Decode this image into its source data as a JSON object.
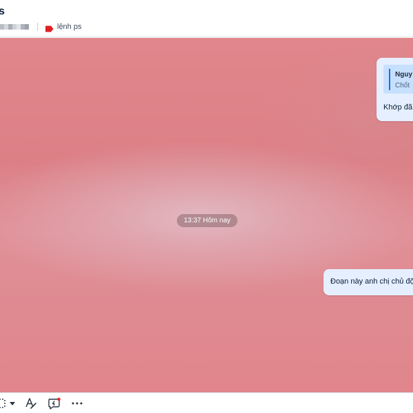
{
  "header": {
    "title": "s",
    "tag_label": "lệnh ps",
    "tag_color": "#e02020"
  },
  "chat": {
    "reply_bubble": {
      "quote_author": "Nguy",
      "quote_text": "Chốt",
      "text": "Khớp đã"
    },
    "timestamp": "13:37 Hôm nay",
    "message_bubble": {
      "text": "Đoạn này anh chị chủ độ"
    },
    "bubble_color": "#e5efff"
  },
  "toolbar": {
    "icons": [
      "screenshot-icon",
      "dropdown-caret-icon",
      "text-format-icon",
      "quick-message-icon",
      "more-icon"
    ]
  }
}
